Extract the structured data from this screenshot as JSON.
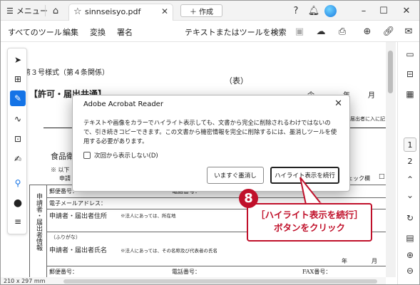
{
  "titlebar": {
    "menu_label": "メニュー",
    "tab_name": "sinnseisyo.pdf",
    "new_button_label": "作成"
  },
  "toolbar": {
    "menu": [
      "すべてのツール",
      "編集",
      "変換",
      "署名"
    ],
    "search_label": "テキストまたはツールを検索"
  },
  "right_rail": {
    "pages": [
      "1",
      "2"
    ],
    "current_page": "1"
  },
  "status": {
    "page_size": "210 x 297 mm"
  },
  "document": {
    "form_no": "第３号様式（第４条関係）",
    "side_label": "（表）",
    "section_title": "【許可・届出共通】",
    "right_header_1": "令",
    "right_header_2": "年",
    "right_header_3": "月",
    "note_right": "届出者に入に記",
    "food_text": "食品衛",
    "bullet_text": "※ 以下",
    "applicant_short": "申請",
    "check_label": "チェック欄",
    "col_label": "申請者・届出者情報",
    "row_postal": "郵便番号：",
    "row_phone": "電話番号：",
    "row_email": "電子メールアドレス：",
    "row_address": "申請者・届出者住所",
    "row_address_note": "※法人にあっては、所在地",
    "row_furigana": "（ふりがな）",
    "row_name": "申請者・届出者氏名",
    "row_name_note": "※法人にあっては、その名称及び代表者の氏名",
    "row_year": "年",
    "row_month": "月",
    "row_postal_2": "郵便番号：",
    "row_phone_2": "電話番号：",
    "row_fax": "FAX番号："
  },
  "dialog": {
    "title": "Adobe Acrobat Reader",
    "body": "テキストや画像をカラーでハイライト表示しても、文書から完全に削除されるわけではないので、引き続きコピーできます。この文書から機密情報を完全に削除するには、墨消しツールを使用する必要があります。",
    "checkbox_label": "次回から表示しない(D)",
    "button_redact": "いますぐ墨消し",
    "button_continue": "ハイライト表示を続行"
  },
  "callout": {
    "number": "8",
    "line1": "［ハイライト表示を続行］",
    "line2": "ボタンをクリック"
  },
  "colors": {
    "accent": "#1473e6",
    "callout_red": "#c0102a"
  }
}
